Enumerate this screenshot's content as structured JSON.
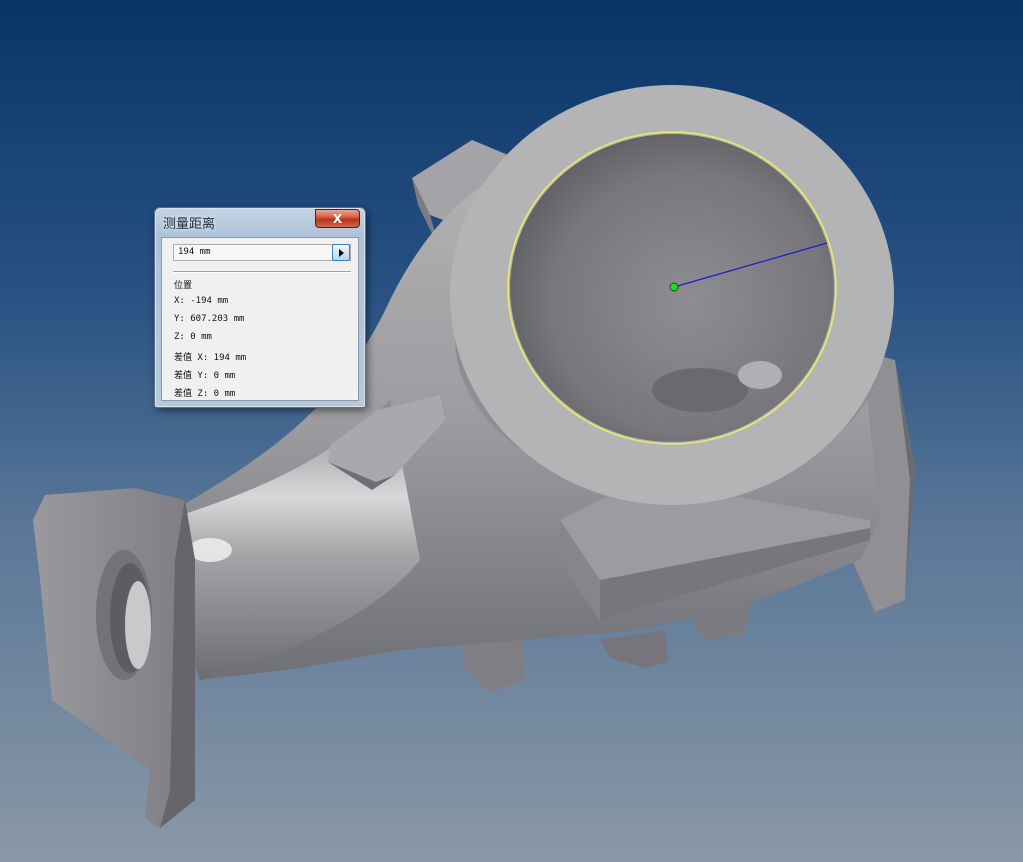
{
  "dialog": {
    "title": "测量距离",
    "close_label": "X",
    "distance_value": "194 mm",
    "section_label": "位置",
    "rows": [
      "X: -194 mm",
      "Y: 607.203 mm",
      "Z: 0 mm",
      "差值 X: 194 mm",
      "差值 Y: 0 mm",
      "差值 Z: 0 mm"
    ]
  },
  "colors": {
    "background_top": "#083466",
    "background_bottom": "#8a98a6",
    "model_gray": "#a0a0a2",
    "selection_edge": "#ecec60",
    "measure_line": "#1a1ad0",
    "center_point": "#22dd22"
  },
  "icons": {
    "close": "close-icon",
    "expand": "right-arrow-icon"
  }
}
